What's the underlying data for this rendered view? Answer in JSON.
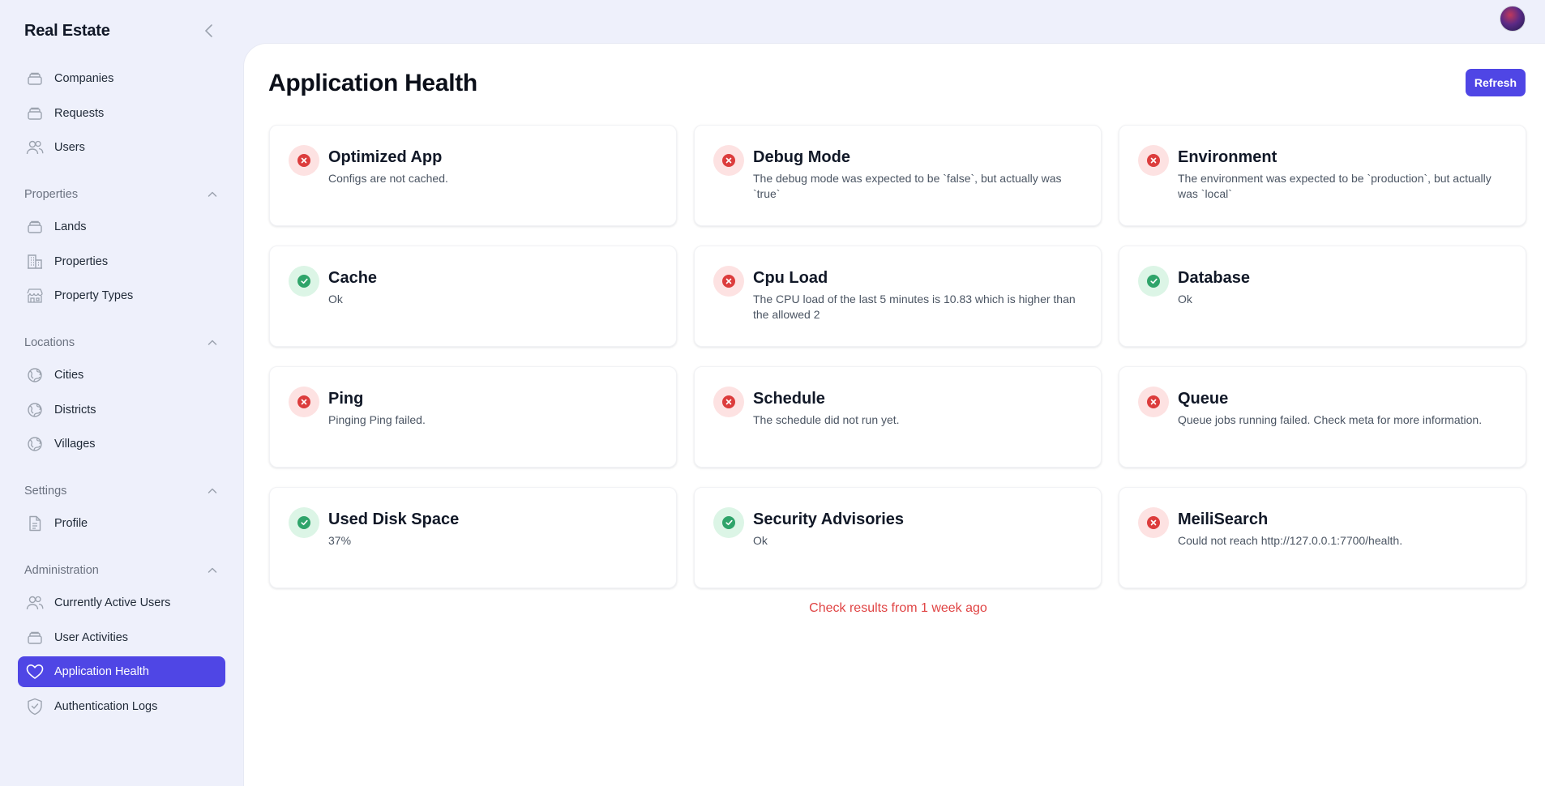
{
  "app": {
    "title": "Real Estate"
  },
  "sidebar": {
    "top_items": [
      {
        "label": "Companies",
        "icon": "stack-icon"
      },
      {
        "label": "Requests",
        "icon": "stack-icon"
      },
      {
        "label": "Users",
        "icon": "users-icon"
      }
    ],
    "groups": [
      {
        "label": "Properties",
        "items": [
          {
            "label": "Lands",
            "icon": "stack-icon"
          },
          {
            "label": "Properties",
            "icon": "building-icon"
          },
          {
            "label": "Property Types",
            "icon": "storefront-icon"
          }
        ]
      },
      {
        "label": "Locations",
        "items": [
          {
            "label": "Cities",
            "icon": "globe-icon"
          },
          {
            "label": "Districts",
            "icon": "globe-icon"
          },
          {
            "label": "Villages",
            "icon": "globe-icon"
          }
        ]
      },
      {
        "label": "Settings",
        "items": [
          {
            "label": "Profile",
            "icon": "document-icon"
          }
        ]
      },
      {
        "label": "Administration",
        "items": [
          {
            "label": "Currently Active Users",
            "icon": "users-icon"
          },
          {
            "label": "User Activities",
            "icon": "stack-icon"
          },
          {
            "label": "Application Health",
            "icon": "heart-icon",
            "active": true
          },
          {
            "label": "Authentication Logs",
            "icon": "shield-check-icon"
          }
        ]
      }
    ]
  },
  "main": {
    "title": "Application Health",
    "refresh_label": "Refresh",
    "checks": [
      {
        "name": "Optimized App",
        "status": "failed",
        "message": "Configs are not cached."
      },
      {
        "name": "Debug Mode",
        "status": "failed",
        "message": "The debug mode was expected to be `false`, but actually was `true`"
      },
      {
        "name": "Environment",
        "status": "failed",
        "message": "The environment was expected to be `production`, but actually was `local`"
      },
      {
        "name": "Cache",
        "status": "ok",
        "message": "Ok"
      },
      {
        "name": "Cpu Load",
        "status": "failed",
        "message": "The CPU load of the last 5 minutes is 10.83 which is higher than the allowed 2"
      },
      {
        "name": "Database",
        "status": "ok",
        "message": "Ok"
      },
      {
        "name": "Ping",
        "status": "failed",
        "message": "Pinging Ping failed."
      },
      {
        "name": "Schedule",
        "status": "failed",
        "message": "The schedule did not run yet."
      },
      {
        "name": "Queue",
        "status": "failed",
        "message": "Queue jobs running failed. Check meta for more information."
      },
      {
        "name": "Used Disk Space",
        "status": "ok",
        "message": "37%"
      },
      {
        "name": "Security Advisories",
        "status": "ok",
        "message": "Ok"
      },
      {
        "name": "MeiliSearch",
        "status": "failed",
        "message": "Could not reach http://127.0.0.1:7700/health."
      }
    ],
    "footer_note": "Check results from 1 week ago"
  },
  "colors": {
    "accent": "#4f46e5",
    "fail": "#dc3c3c",
    "ok": "#2fa46a",
    "note": "#e04444"
  }
}
